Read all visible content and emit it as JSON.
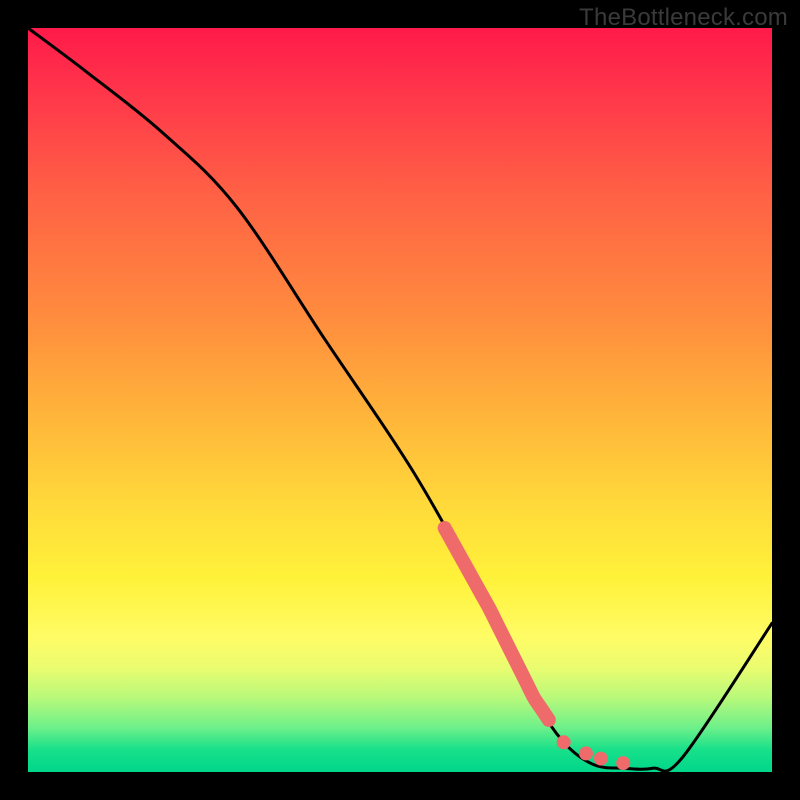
{
  "watermark": "TheBottleneck.com",
  "chart_data": {
    "type": "line",
    "title": "",
    "xlabel": "",
    "ylabel": "",
    "xlim": [
      0,
      100
    ],
    "ylim": [
      0,
      100
    ],
    "series": [
      {
        "name": "curve",
        "x": [
          0,
          8,
          18,
          28,
          40,
          52,
          62,
          68,
          72,
          76,
          80,
          84,
          88,
          100
        ],
        "values": [
          100,
          94,
          86,
          76,
          58,
          40,
          22,
          10,
          4,
          1,
          0.5,
          0.5,
          2,
          20
        ]
      }
    ],
    "highlight_segment": {
      "x0": 56,
      "x1": 70
    },
    "dots": [
      {
        "x": 72,
        "y": 4
      },
      {
        "x": 75,
        "y": 2.5
      },
      {
        "x": 77,
        "y": 1.8
      },
      {
        "x": 80,
        "y": 1.2
      }
    ],
    "colors": {
      "line": "#000000",
      "highlight": "#ef6a6a",
      "dot": "#ef6a6a"
    }
  }
}
